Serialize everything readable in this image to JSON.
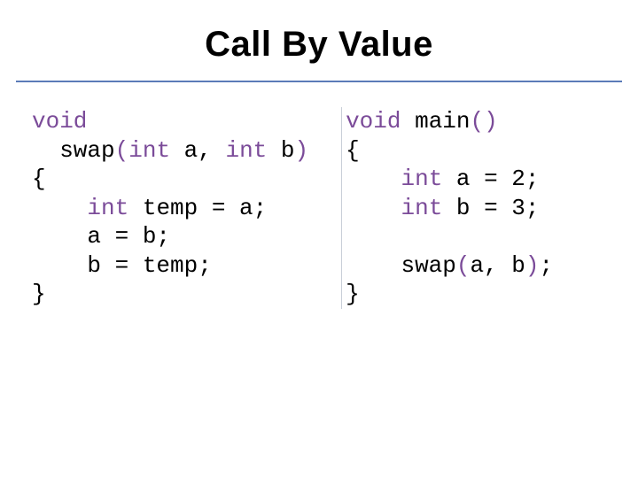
{
  "title": "Call By Value",
  "code_left": {
    "tokens": [
      {
        "kind": "kw",
        "text": "void"
      },
      {
        "kind": "txt",
        "text": "\n  swap"
      },
      {
        "kind": "paren",
        "text": "("
      },
      {
        "kind": "kw",
        "text": "int"
      },
      {
        "kind": "txt",
        "text": " a, "
      },
      {
        "kind": "kw",
        "text": "int"
      },
      {
        "kind": "txt",
        "text": " b"
      },
      {
        "kind": "paren",
        "text": ")"
      },
      {
        "kind": "txt",
        "text": "\n{\n    "
      },
      {
        "kind": "kw",
        "text": "int"
      },
      {
        "kind": "txt",
        "text": " temp = a;\n    a = b;\n    b = temp;\n}"
      }
    ]
  },
  "code_right": {
    "tokens": [
      {
        "kind": "kw",
        "text": "void"
      },
      {
        "kind": "txt",
        "text": " main"
      },
      {
        "kind": "paren",
        "text": "()"
      },
      {
        "kind": "txt",
        "text": "\n{\n    "
      },
      {
        "kind": "kw",
        "text": "int"
      },
      {
        "kind": "txt",
        "text": " a = 2;\n    "
      },
      {
        "kind": "kw",
        "text": "int"
      },
      {
        "kind": "txt",
        "text": " b = 3;\n\n    swap"
      },
      {
        "kind": "paren",
        "text": "("
      },
      {
        "kind": "txt",
        "text": "a, b"
      },
      {
        "kind": "paren",
        "text": ")"
      },
      {
        "kind": "txt",
        "text": ";\n}"
      }
    ]
  }
}
